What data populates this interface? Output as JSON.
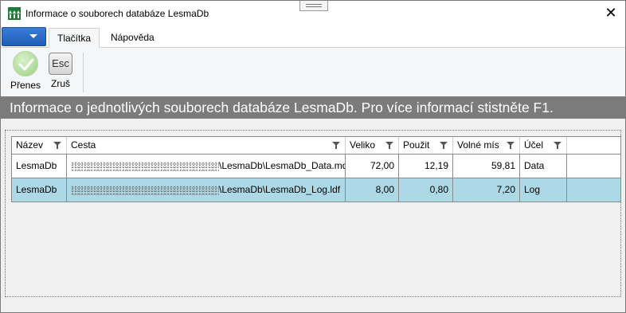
{
  "window": {
    "title": "Informace o souborech databáze LesmaDb",
    "close_glyph": "✕"
  },
  "ribbon": {
    "tabs": [
      {
        "label": "Tlačítka",
        "active": true
      },
      {
        "label": "Nápověda",
        "active": false
      }
    ],
    "buttons": [
      {
        "label": "Přenes",
        "icon": "check-circle-icon"
      },
      {
        "label": "Zruš",
        "icon": "esc-key-icon",
        "icon_text": "Esc"
      }
    ]
  },
  "banner": {
    "text": "Informace o jednotlivých souborech databáze LesmaDb. Pro více informací stistněte F1."
  },
  "grid": {
    "columns": [
      "Název",
      "Cesta",
      "Veliko",
      "Použit",
      "Volné mís",
      "Účel",
      ""
    ],
    "rows": [
      {
        "name": "LesmaDb",
        "path": "\\LesmaDb\\LesmaDb_Data.mdf",
        "size": "72,00",
        "used": "12,19",
        "free": "59,81",
        "purpose": "Data",
        "selected": false
      },
      {
        "name": "LesmaDb",
        "path": "\\LesmaDb\\LesmaDb_Log.ldf",
        "size": "8,00",
        "used": "0,80",
        "free": "7,20",
        "purpose": "Log",
        "selected": true
      }
    ]
  },
  "colors": {
    "banner_bg": "#7b7b7b",
    "selected_row": "#add8e6",
    "file_menu": "#1f5db8"
  }
}
